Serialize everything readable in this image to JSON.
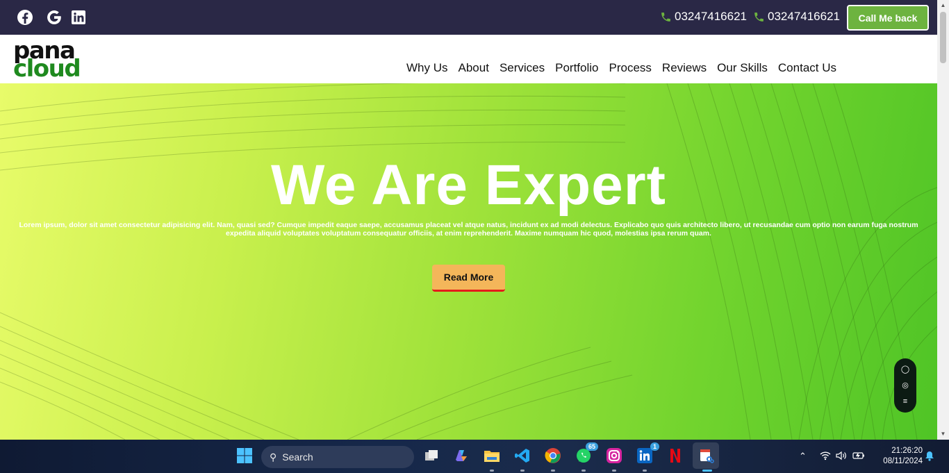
{
  "topbar": {
    "social_icons": [
      "facebook-icon",
      "google-icon",
      "linkedin-icon"
    ],
    "phones": [
      "03247416621",
      "03247416621"
    ],
    "callback_label": "Call Me back",
    "background": "#2a2846",
    "accent": "#6db33f"
  },
  "logo": {
    "line1": "pana",
    "line2": "cloud"
  },
  "nav": {
    "items": [
      "Why Us",
      "About",
      "Services",
      "Portfolio",
      "Process",
      "Reviews",
      "Our Skills",
      "Contact Us"
    ]
  },
  "hero": {
    "title": "We Are Expert",
    "text": "Lorem ipsum, dolor sit amet consectetur adipisicing elit. Nam, quasi sed? Cumque impedit eaque saepe, accusamus placeat vel atque natus, incidunt ex ad modi delectus. Explicabo quo quis architecto libero, ut recusandae cum optio non earum fuga nostrum expedita aliquid voluptates voluptatum consequatur officiis, at enim reprehenderit. Maxime numquam hic quod, molestias ipsa rerum quam.",
    "button_label": "Read More"
  },
  "widget": {
    "icons": [
      "chat-icon",
      "toggle-icon",
      "list-icon"
    ]
  },
  "taskbar": {
    "search_label": "Search",
    "apps": [
      {
        "name": "start-icon"
      },
      {
        "name": "task-view-icon"
      },
      {
        "name": "copilot-icon"
      },
      {
        "name": "file-explorer-icon"
      },
      {
        "name": "vscode-icon"
      },
      {
        "name": "chrome-icon"
      },
      {
        "name": "whatsapp-icon",
        "badge": "65"
      },
      {
        "name": "instagram-icon"
      },
      {
        "name": "linkedin-app-icon",
        "badge": "1"
      },
      {
        "name": "netflix-icon"
      },
      {
        "name": "snipping-tool-icon"
      }
    ],
    "time": "21:26:20",
    "date": "08/11/2024"
  }
}
